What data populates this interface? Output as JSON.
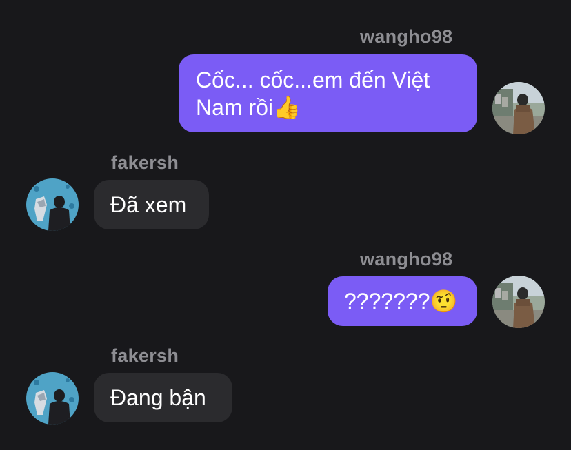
{
  "messages": [
    {
      "sender": "wangho98",
      "side": "right",
      "text": "Cốc... cốc...em đến Việt Nam rồi👍",
      "line1": "Cốc... cốc...em đến Việt",
      "line2": "Nam rồi👍"
    },
    {
      "sender": "fakersh",
      "side": "left",
      "text": "Đã xem"
    },
    {
      "sender": "wangho98",
      "side": "right",
      "text": "???????🤨"
    },
    {
      "sender": "fakersh",
      "side": "left",
      "text": "Đang bận"
    }
  ],
  "colors": {
    "background": "#18181b",
    "outgoing_bubble": "#7b5cf5",
    "incoming_bubble": "#2b2b2e",
    "username": "#8e8e93",
    "text": "#ffffff"
  },
  "icons": {
    "wangho98_avatar": "avatar-photo-person-street",
    "fakersh_avatar": "avatar-photo-person-trophy"
  }
}
